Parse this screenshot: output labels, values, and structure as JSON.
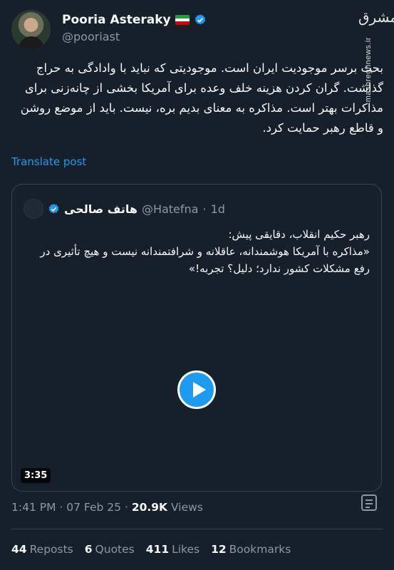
{
  "author": {
    "display_name": "Pooria Asteraky",
    "handle": "@pooriast",
    "flag_colors": [
      "#239f40",
      "#ffffff",
      "#da0000"
    ]
  },
  "watermark": {
    "logo": "مشرق",
    "url": "mashreghnews.ir"
  },
  "post": {
    "text": "بحث برسر موجودیت ایران است. موجودیتی که نباید با وادادگی به حراج گذاشت. گران کردن هزینه خلف وعده برای آمریکا بخشی از چانه‌زنی برای مذاکرات بهتر است. مذاکره به معنای بدیم بره، نیست. باید از موضع روشن و قاطع رهبر حمایت کرد.",
    "translate_label": "Translate post"
  },
  "quote": {
    "display_name": "هاتف صالحی",
    "handle": "@Hatefna",
    "age": "1d",
    "text": "رهبر حکیم انقلاب، دقایقی پیش:\n«مذاکره با آمریکا هوشمندانه، عاقلانه و شرافتمندانه نیست و هیچ تأثیری در رفع مشکلات کشور ندارد؛ دلیل؟ تجربه!»",
    "video_duration": "3:35"
  },
  "meta": {
    "time": "1:41 PM",
    "date": "07 Feb 25",
    "views_count": "20.9K",
    "views_label": "Views"
  },
  "stats": {
    "reposts": {
      "count": "44",
      "label": "Reposts"
    },
    "quotes": {
      "count": "6",
      "label": "Quotes"
    },
    "likes": {
      "count": "411",
      "label": "Likes"
    },
    "bookmarks": {
      "count": "12",
      "label": "Bookmarks"
    }
  },
  "colors": {
    "background": "#15202b",
    "accent": "#1d9bf0",
    "muted": "#8b98a5"
  }
}
